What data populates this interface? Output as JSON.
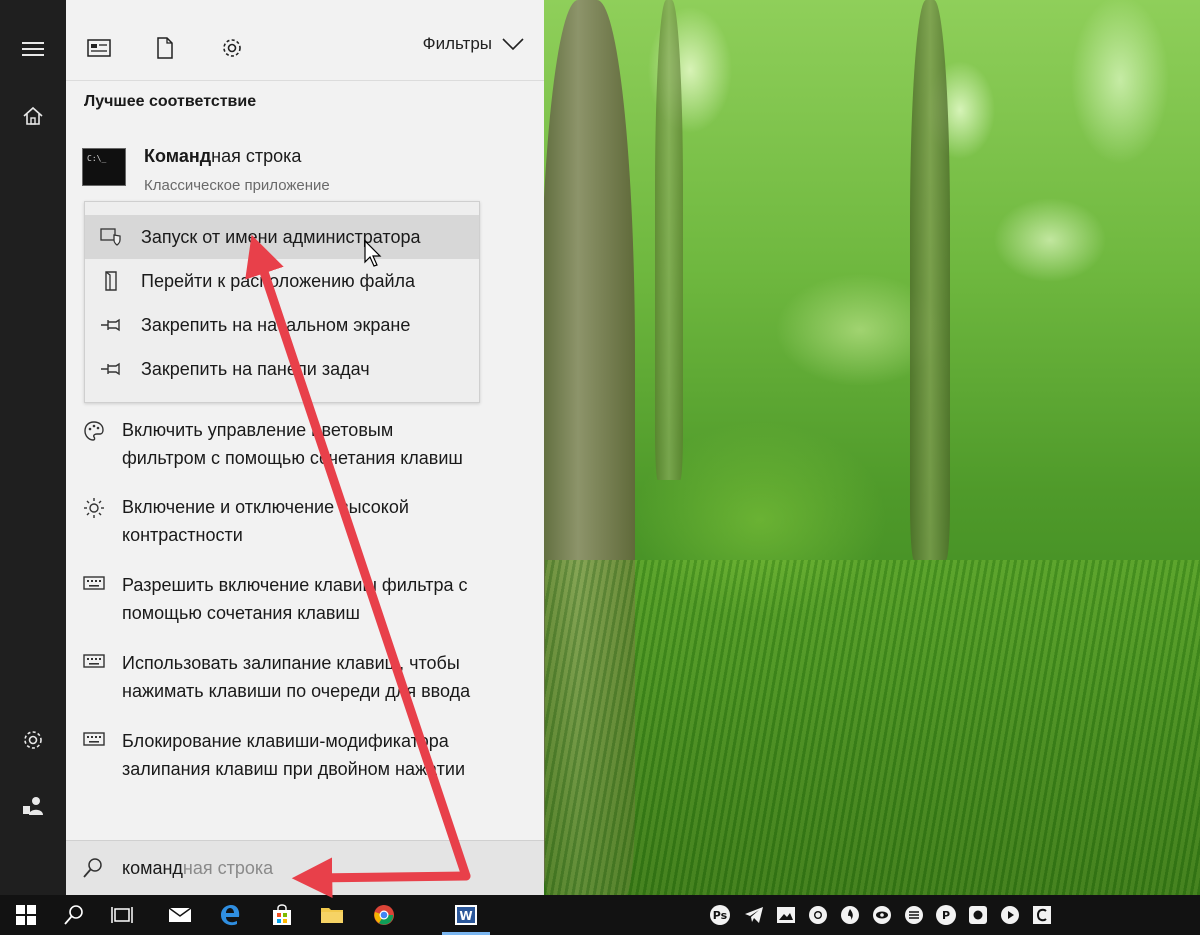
{
  "panel": {
    "filters_label": "Фильтры",
    "best_match_header": "Лучшее соответствие",
    "best_match": {
      "title_bold": "Команд",
      "title_rest": "ная строка",
      "subtitle": "Классическое приложение",
      "icon_text": "C:\\_"
    },
    "context_menu": [
      {
        "label": "Запуск от имени администратора",
        "icon": "admin-shield-icon"
      },
      {
        "label": "Перейти к расположению файла",
        "icon": "file-location-icon"
      },
      {
        "label": "Закрепить на начальном экране",
        "icon": "pin-icon"
      },
      {
        "label": "Закрепить на панели задач",
        "icon": "pin-icon"
      }
    ],
    "results": [
      {
        "line1": "Включить управление цветовым",
        "line2": "фильтром с помощью сочетания клавиш",
        "icon": "palette-icon"
      },
      {
        "line1": "Включение и отключение высокой",
        "line2": "контрастности",
        "icon": "brightness-icon"
      },
      {
        "line1": "Разрешить включение клавиш фильтра с",
        "line2": "помощью сочетания клавиш",
        "icon": "keyboard-icon"
      },
      {
        "line1": "Использовать залипание клавиш, чтобы",
        "line2": "нажимать клавиши по очереди для ввода",
        "icon": "keyboard-icon"
      },
      {
        "line1": "Блокирование клавиши-модификатора",
        "line2": "залипания клавиш при двойном нажатии",
        "icon": "keyboard-icon"
      }
    ],
    "search": {
      "typed": "команд",
      "suggestion": "ная строка"
    }
  },
  "colors": {
    "annotation_red": "#e8404a",
    "panel_bg": "#f2f2f2",
    "rail_bg": "#1f1f1f",
    "taskbar_bg": "#121212"
  },
  "taskbar": {
    "tray_letters": [
      "Ps",
      "P"
    ]
  }
}
